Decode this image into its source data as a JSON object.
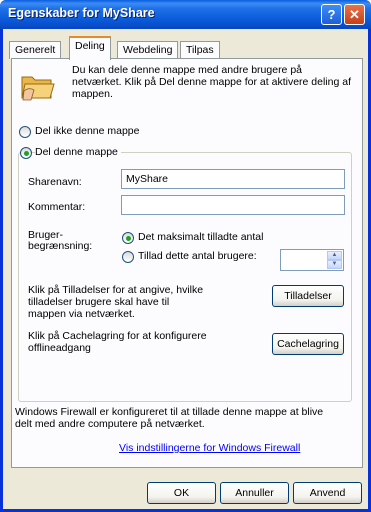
{
  "window": {
    "title": "Egenskaber for MyShare"
  },
  "titlebar": {
    "help_glyph": "?",
    "close_glyph": "✕"
  },
  "tabs": [
    {
      "label": "Generelt"
    },
    {
      "label": "Deling"
    },
    {
      "label": "Webdeling"
    },
    {
      "label": "Tilpas"
    }
  ],
  "intro_text": "Du kan dele denne mappe med andre brugere på netværket. Klik på Del denne mappe for at aktivere deling af mappen.",
  "share_options": {
    "dont_share": "Del ikke denne mappe",
    "share": "Del denne mappe"
  },
  "fields": {
    "share_name_label": "Sharenavn:",
    "share_name_value": "MyShare",
    "comment_label": "Kommentar:",
    "comment_value": ""
  },
  "user_limit": {
    "label_line1": "Bruger-",
    "label_line2": "begrænsning:",
    "max_allowed": "Det maksimalt tilladte antal",
    "allow_this_number": "Tillad dette antal brugere:",
    "spinner_value": ""
  },
  "permissions": {
    "text": "Klik på Tilladelser for at angive, hvilke tilladelser brugere skal have til mappen via netværket.",
    "button": "Tilladelser"
  },
  "caching": {
    "text": "Klik på Cachelagring for at konfigurere offlineadgang",
    "button": "Cachelagring"
  },
  "firewall": {
    "text": "Windows Firewall er konfigureret til at tillade denne mappe at blive delt med andre computere på netværket.",
    "link": "Vis indstillingerne for Windows Firewall"
  },
  "buttons": {
    "ok": "OK",
    "cancel": "Annuller",
    "apply": "Anvend"
  }
}
